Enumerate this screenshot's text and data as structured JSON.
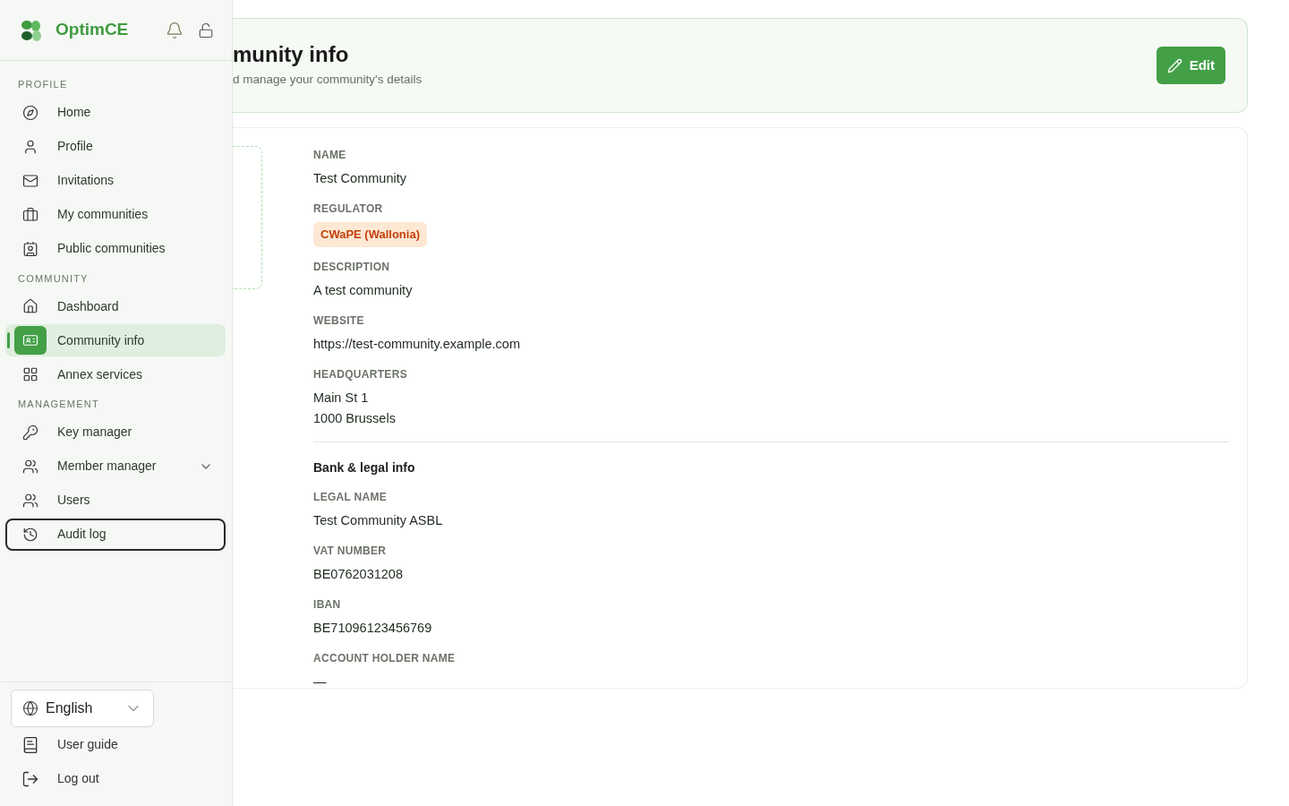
{
  "brand": {
    "name": "OptimCE"
  },
  "sidebar": {
    "sections": [
      {
        "title": "PROFILE",
        "items": [
          {
            "label": "Home",
            "kind": "compass",
            "selected": false,
            "focused": false
          },
          {
            "label": "Profile",
            "kind": "user",
            "selected": false,
            "focused": false
          },
          {
            "label": "Invitations",
            "kind": "mail",
            "selected": false,
            "focused": false
          },
          {
            "label": "My communities",
            "kind": "briefcase",
            "selected": false,
            "focused": false
          },
          {
            "label": "Public communities",
            "kind": "contact",
            "selected": false,
            "focused": false
          }
        ]
      },
      {
        "title": "COMMUNITY",
        "items": [
          {
            "label": "Dashboard",
            "kind": "home",
            "selected": false,
            "focused": false
          },
          {
            "label": "Community info",
            "kind": "idcard",
            "selected": true,
            "focused": false
          },
          {
            "label": "Annex services",
            "kind": "grid",
            "selected": false,
            "focused": false
          }
        ]
      },
      {
        "title": "MANAGEMENT",
        "items": [
          {
            "label": "Key manager",
            "kind": "key",
            "selected": false,
            "focused": false
          },
          {
            "label": "Member manager",
            "kind": "users",
            "selected": false,
            "focused": false,
            "expanded": false
          },
          {
            "label": "Users",
            "kind": "users",
            "selected": false,
            "focused": false
          },
          {
            "label": "Audit log",
            "kind": "history",
            "selected": false,
            "focused": true
          }
        ]
      }
    ],
    "language": "English",
    "footer_links": [
      {
        "label": "User guide",
        "kind": "book"
      },
      {
        "label": "Log out",
        "kind": "logout"
      }
    ]
  },
  "header": {
    "title": "munity info",
    "subtitle": "d manage your community's details",
    "edit_button": "Edit"
  },
  "details": {
    "fields": [
      {
        "label": "NAME",
        "kind": "text",
        "value": [
          "Test Community"
        ]
      },
      {
        "label": "REGULATOR",
        "kind": "badge",
        "value": [
          "CWaPE (Wallonia)"
        ]
      },
      {
        "label": "DESCRIPTION",
        "kind": "text",
        "value": [
          "A test community"
        ]
      },
      {
        "label": "WEBSITE",
        "kind": "text",
        "value": [
          "https://test-community.example.com"
        ]
      },
      {
        "label": "HEADQUARTERS",
        "kind": "text",
        "value": [
          "Main St 1",
          "1000 Brussels"
        ]
      }
    ],
    "bank_title": "Bank & legal info",
    "bank_fields": [
      {
        "label": "LEGAL NAME",
        "kind": "text",
        "value": [
          "Test Community ASBL"
        ]
      },
      {
        "label": "VAT NUMBER",
        "kind": "text",
        "value": [
          "BE0762031208"
        ]
      },
      {
        "label": "IBAN",
        "kind": "text",
        "value": [
          "BE71096123456769"
        ]
      },
      {
        "label": "ACCOUNT HOLDER NAME",
        "kind": "text",
        "value": [
          "—"
        ]
      }
    ]
  }
}
